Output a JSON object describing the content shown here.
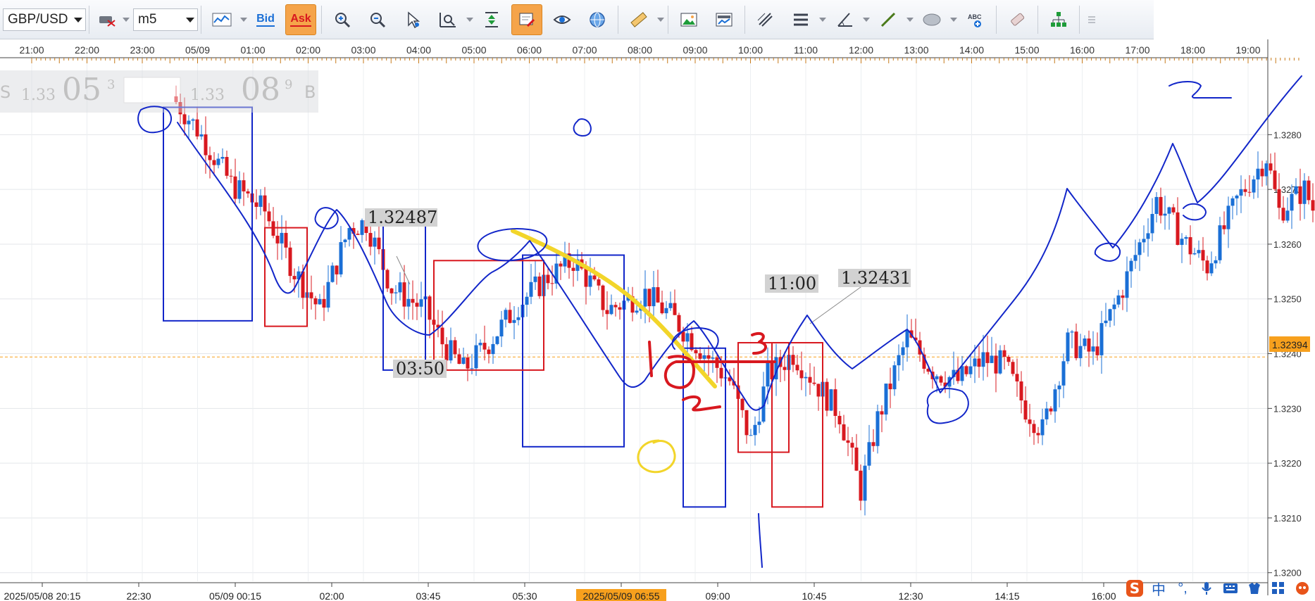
{
  "toolbar": {
    "symbol": "GBP/USD",
    "timeframe": "m5",
    "bid_label": "Bid",
    "ask_label": "Ask",
    "icons": [
      "chart-type-icon",
      "zoom-in-icon",
      "zoom-out-icon",
      "cursor-icon",
      "zoom-range-icon",
      "fit-height-icon",
      "note-icon",
      "eye-icon",
      "globe-icon",
      "ruler-icon",
      "image-icon",
      "chart-image-icon",
      "trend-tools-icon",
      "lines-icon",
      "angle-icon",
      "line-draw-icon",
      "ellipse-icon",
      "text-label-icon",
      "eraser-icon",
      "hierarchy-icon",
      "more-icon"
    ]
  },
  "quote_panel": {
    "sell": "S",
    "sell_prefix": "1.33",
    "sell_big": "05",
    "sell_sup": "3",
    "buy_prefix": "1.33",
    "buy_big": "08",
    "buy_sup": "9",
    "buy": "B"
  },
  "chart_data": {
    "type": "candlestick",
    "symbol": "GBP/USD",
    "timeframe": "m5",
    "ylim": [
      1.3195,
      1.3305
    ],
    "y_ticks": [
      "1.3200",
      "1.3210",
      "1.3220",
      "1.3230",
      "1.3240",
      "1.3250",
      "1.3260",
      "1.3270",
      "1.3280"
    ],
    "current_price": "1.32394",
    "top_time_ticks": [
      "21:00",
      "22:00",
      "23:00",
      "05/09",
      "01:00",
      "02:00",
      "03:00",
      "04:00",
      "05:00",
      "06:00",
      "07:00",
      "08:00",
      "09:00",
      "10:00",
      "11:00",
      "12:00",
      "13:00",
      "14:00",
      "15:00",
      "16:00",
      "17:00",
      "18:00",
      "19:00"
    ],
    "bottom_time_ticks": [
      "2025/05/08 20:15",
      "22:30",
      "05/09 00:15",
      "02:00",
      "03:45",
      "05:30",
      "2025/05/09 06:55",
      "09:00",
      "10:45",
      "12:30",
      "14:15",
      "16:00"
    ],
    "highlighted_time": "2025/05/09 06:55",
    "annotations": [
      "1.32487",
      "03:50",
      "11:00",
      "1.32431"
    ],
    "anchors": [
      {
        "t": 0,
        "p": 1.3287
      },
      {
        "t": 6,
        "p": 1.3281
      },
      {
        "t": 14,
        "p": 1.3271
      },
      {
        "t": 22,
        "p": 1.3266
      },
      {
        "t": 29,
        "p": 1.3255
      },
      {
        "t": 35,
        "p": 1.3248
      },
      {
        "t": 42,
        "p": 1.3263
      },
      {
        "t": 46,
        "p": 1.3264
      },
      {
        "t": 52,
        "p": 1.3252
      },
      {
        "t": 60,
        "p": 1.3248
      },
      {
        "t": 64,
        "p": 1.3242
      },
      {
        "t": 69,
        "p": 1.3237
      },
      {
        "t": 75,
        "p": 1.3242
      },
      {
        "t": 82,
        "p": 1.3249
      },
      {
        "t": 89,
        "p": 1.3254
      },
      {
        "t": 95,
        "p": 1.3257
      },
      {
        "t": 99,
        "p": 1.3253
      },
      {
        "t": 103,
        "p": 1.3248
      },
      {
        "t": 112,
        "p": 1.3251
      },
      {
        "t": 118,
        "p": 1.3247
      },
      {
        "t": 125,
        "p": 1.3241
      },
      {
        "t": 132,
        "p": 1.3235
      },
      {
        "t": 137,
        "p": 1.3224
      },
      {
        "t": 141,
        "p": 1.3236
      },
      {
        "t": 147,
        "p": 1.324
      },
      {
        "t": 152,
        "p": 1.3235
      },
      {
        "t": 158,
        "p": 1.3229
      },
      {
        "t": 163,
        "p": 1.3215
      },
      {
        "t": 167,
        "p": 1.3228
      },
      {
        "t": 174,
        "p": 1.3243
      },
      {
        "t": 180,
        "p": 1.3237
      },
      {
        "t": 186,
        "p": 1.3235
      },
      {
        "t": 192,
        "p": 1.3239
      },
      {
        "t": 197,
        "p": 1.3238
      },
      {
        "t": 202,
        "p": 1.323
      },
      {
        "t": 206,
        "p": 1.3226
      },
      {
        "t": 212,
        "p": 1.3242
      },
      {
        "t": 218,
        "p": 1.324
      },
      {
        "t": 225,
        "p": 1.3252
      },
      {
        "t": 233,
        "p": 1.3268
      },
      {
        "t": 240,
        "p": 1.326
      },
      {
        "t": 245,
        "p": 1.3256
      },
      {
        "t": 252,
        "p": 1.3268
      },
      {
        "t": 259,
        "p": 1.3276
      },
      {
        "t": 262,
        "p": 1.3266
      },
      {
        "t": 268,
        "p": 1.327
      },
      {
        "t": 272,
        "p": 1.3263
      },
      {
        "t": 278,
        "p": 1.327
      },
      {
        "t": 284,
        "p": 1.3268
      },
      {
        "t": 287,
        "p": 1.3285
      }
    ],
    "blue_boxes": [
      {
        "t0": -3,
        "t1": 18,
        "p0": 1.3246,
        "p1": 1.3285
      },
      {
        "t0": 49,
        "t1": 59,
        "p0": 1.3237,
        "p1": 1.3265
      },
      {
        "t0": 82,
        "t1": 106,
        "p0": 1.3223,
        "p1": 1.3258
      },
      {
        "t0": 120,
        "t1": 130,
        "p0": 1.3212,
        "p1": 1.3241
      }
    ],
    "red_boxes": [
      {
        "t0": 21,
        "t1": 31,
        "p0": 1.3245,
        "p1": 1.3263
      },
      {
        "t0": 61,
        "t1": 87,
        "p0": 1.3237,
        "p1": 1.3257
      },
      {
        "t0": 133,
        "t1": 145,
        "p0": 1.3222,
        "p1": 1.3242
      },
      {
        "t0": 141,
        "t1": 153,
        "p0": 1.3212,
        "p1": 1.3242
      }
    ]
  },
  "colors": {
    "bull": "#1a6fd6",
    "bear": "#d8181f",
    "pen": "#1226c9",
    "highlighter": "#f2d52a",
    "price_tag": "#f7a01d",
    "ask_active": "#f5a44a"
  }
}
